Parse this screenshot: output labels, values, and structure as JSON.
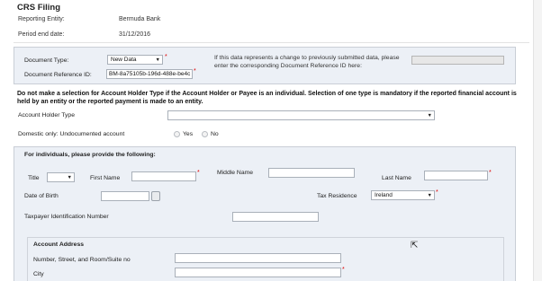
{
  "page": {
    "title": "CRS Filing",
    "reporting_entity_label": "Reporting Entity:",
    "reporting_entity_value": "Bermuda Bank",
    "period_end_label": "Period end date:",
    "period_end_value": "31/12/2016"
  },
  "document": {
    "type_label": "Document Type:",
    "type_value": "New Data",
    "ref_label": "Document Reference ID:",
    "ref_value": "BM-8a75105b-196d-488e-be4c",
    "change_note": "If this data represents a change to previously submitted data, please enter the corresponding Document Reference ID here:"
  },
  "holder": {
    "instruction": "Do not make a selection for Account Holder Type if the Account Holder or Payee is an individual. Selection of one type is mandatory if the reported financial account is held by an entity or the reported payment is made to an entity.",
    "type_label": "Account Holder Type",
    "type_value": "",
    "domestic_label": "Domestic only: Undocumented account",
    "yes_label": "Yes",
    "no_label": "No"
  },
  "individual": {
    "heading": "For individuals, please provide the following:",
    "title_label": "Title",
    "first_name_label": "First Name",
    "middle_name_label": "Middle Name",
    "last_name_label": "Last Name",
    "dob_label": "Date of Birth",
    "tax_residence_label": "Tax Residence",
    "tax_residence_value": "Ireland",
    "tin_label": "Taxpayer Identification Number"
  },
  "address": {
    "heading": "Account Address",
    "street_label": "Number, Street, and Room/Suite no",
    "city_label": "City"
  },
  "icons": {
    "dropdown": "chevron-down-icon",
    "calendar": "calendar-icon",
    "cursor": "mouse-cursor-icon",
    "required": "required-asterisk"
  },
  "colors": {
    "panel_bg": "#ecf0f6",
    "required": "#dd0000"
  }
}
